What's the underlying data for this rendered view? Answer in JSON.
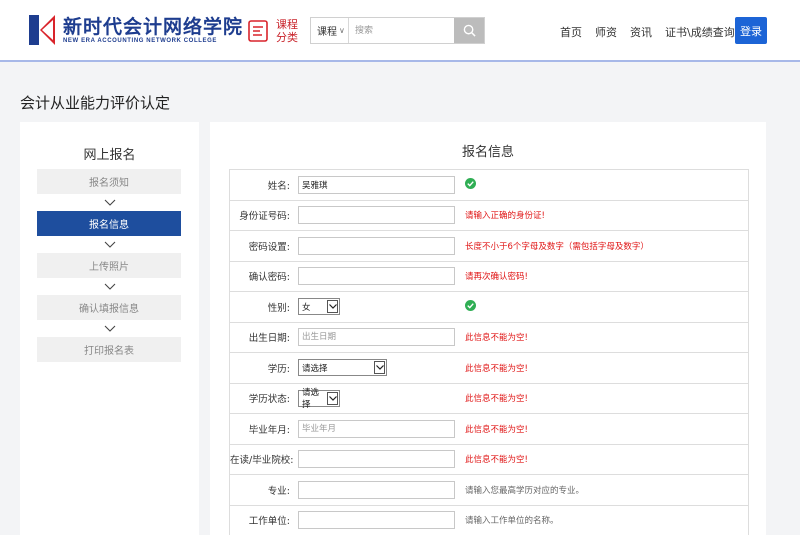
{
  "header": {
    "logo_cn": "新时代会计网络学院",
    "logo_en": "NEW ERA ACCOUNTING NETWORK COLLEGE",
    "category_label": "课程分类",
    "search": {
      "select_value": "课程",
      "placeholder": "搜索"
    },
    "nav": [
      "首页",
      "师资",
      "资讯",
      "证书\\成绩查询"
    ],
    "login_label": "登录",
    "accent_color": "#1c64d6",
    "brand_color": "#1e3d8f"
  },
  "page_title": "会计从业能力评价认定",
  "sidebar": {
    "title": "网上报名",
    "steps": [
      {
        "label": "报名须知",
        "active": false
      },
      {
        "label": "报名信息",
        "active": true
      },
      {
        "label": "上传照片",
        "active": false
      },
      {
        "label": "确认填报信息",
        "active": false
      },
      {
        "label": "打印报名表",
        "active": false
      }
    ]
  },
  "form": {
    "title": "报名信息",
    "rows": [
      {
        "label": "姓名:",
        "value": "吴雅琪",
        "placeholder": "",
        "msg": "",
        "status": "ok"
      },
      {
        "label": "身份证号码:",
        "value": "",
        "placeholder": "",
        "msg": "请输入正确的身份证!",
        "status": "error"
      },
      {
        "label": "密码设置:",
        "value": "",
        "placeholder": "",
        "msg": "长度不小于6个字母及数字（需包括字母及数字）",
        "status": "error"
      },
      {
        "label": "确认密码:",
        "value": "",
        "placeholder": "",
        "msg": "请再次确认密码!",
        "status": "error"
      },
      {
        "label": "性别:",
        "select_value": "女",
        "msg": "",
        "status": "ok"
      },
      {
        "label": "出生日期:",
        "value": "",
        "placeholder": "出生日期",
        "msg": "此信息不能为空!",
        "status": "error"
      },
      {
        "label": "学历:",
        "select_value": "请选择",
        "msg": "此信息不能为空!",
        "status": "error"
      },
      {
        "label": "学历状态:",
        "select_value": "请选择",
        "msg": "此信息不能为空!",
        "status": "error"
      },
      {
        "label": "毕业年月:",
        "value": "",
        "placeholder": "毕业年月",
        "msg": "此信息不能为空!",
        "status": "error"
      },
      {
        "label": "在读/毕业院校:",
        "value": "",
        "placeholder": "",
        "msg": "此信息不能为空!",
        "status": "error"
      },
      {
        "label": "专业:",
        "value": "",
        "placeholder": "",
        "msg": "请输入您最高学历对应的专业。",
        "status": "hint"
      },
      {
        "label": "工作单位:",
        "value": "",
        "placeholder": "",
        "msg": "请输入工作单位的名称。",
        "status": "hint"
      }
    ],
    "ok_color": "#2fae54",
    "error_color": "#e01515"
  }
}
